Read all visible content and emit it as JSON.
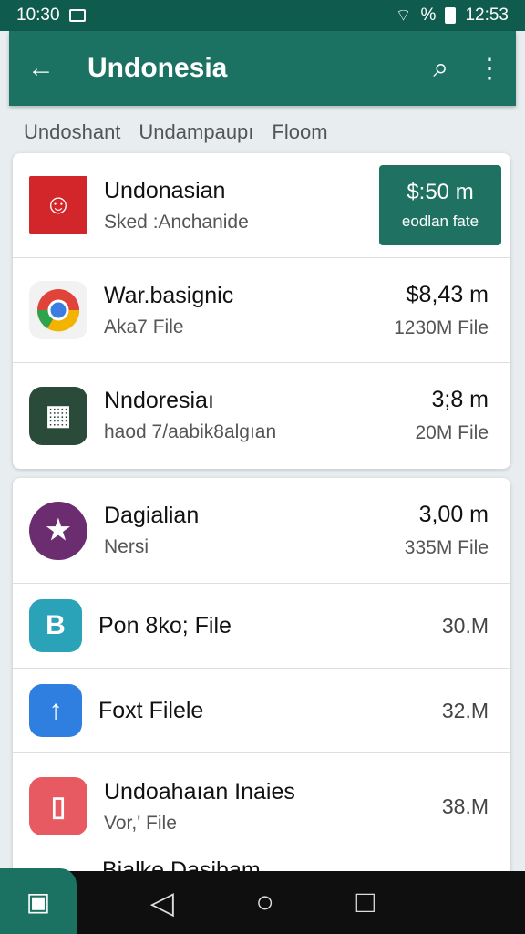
{
  "status": {
    "time_left": "10:30",
    "indicators": "%",
    "time_right": "12:53"
  },
  "appbar": {
    "back_icon": "arrow-left-icon",
    "title": "Undonesia",
    "search_icon": "search-icon",
    "menu_icon": "more-vert-icon"
  },
  "chips": [
    "Undoshant",
    "Undampaupı",
    "Floom"
  ],
  "section1": [
    {
      "name": "Undonasian",
      "sub": "Sked :Anchanide",
      "price": "$:50 m",
      "price_sub": "eodlan fate",
      "icon": "flag-avatar-icon",
      "color": "#d3262b"
    },
    {
      "name": "War.basignic",
      "sub": "Aka7 File",
      "price": "$8,43 m",
      "price_sub": "1230M File",
      "icon": "chrome-icon",
      "color": "#f2f2f2"
    },
    {
      "name": "Nndoresiaı",
      "sub": "haod 7/aabik8algıan",
      "price": "3;8 m",
      "price_sub": "20M File",
      "icon": "gallery-icon",
      "color": "#2a4a3a"
    }
  ],
  "section2": [
    {
      "name": "Dagialian",
      "sub": "Nersi",
      "price": "3,00 m",
      "price_sub": "335M File",
      "icon": "shield-star-icon",
      "color": "#6b2d6f"
    },
    {
      "name": "Pon 8ko; File",
      "sub": "",
      "price": "30.M",
      "icon": "b-logo-icon",
      "color": "#2aa2b8"
    },
    {
      "name": "Foxt Filele",
      "sub": "",
      "price": "32.M",
      "icon": "upload-icon",
      "color": "#2f7fe0"
    },
    {
      "name": "Undoahaıan Inaies",
      "sub": "Vor,' File",
      "price": "38.M",
      "icon": "phone-icon",
      "color": "#e85a62"
    }
  ],
  "peek_text": "Bialke Dasibam",
  "navbar": {
    "back": "◁",
    "home": "○",
    "recents": "□"
  }
}
